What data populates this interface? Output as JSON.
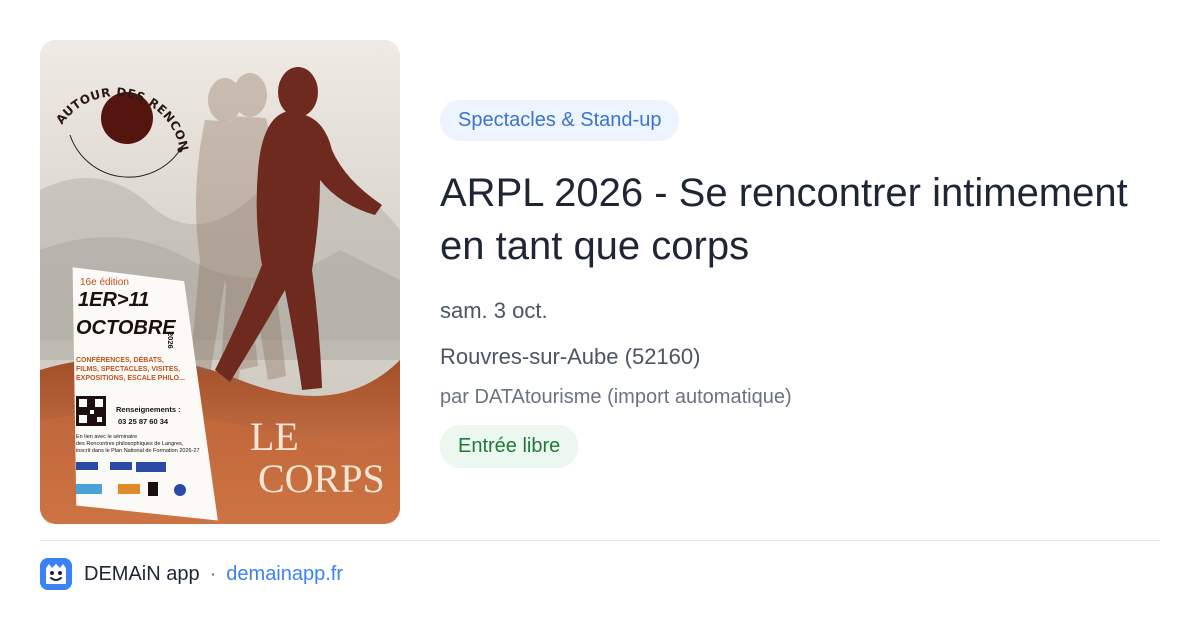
{
  "poster": {
    "arc_text": "AUTOUR DES RENCONTRES PHILOSOPHIQUES DE LANGRES",
    "edition": "16e édition",
    "dates_line1": "1ER>11",
    "dates_line2": "OCTOBRE",
    "year": "2026",
    "activities": [
      "CONFÉRENCES, DÉBATS,",
      "FILMS, SPECTACLES, VISITES,",
      "EXPOSITIONS, ESCALE PHILO..."
    ],
    "info_label": "Renseignements :",
    "info_phone": "03 25 87 60 34",
    "note": [
      "En lien avec le séminaire",
      "des Rencontres philosophiques de Langres,",
      "inscrit dans le Plan National de Formation 2026-27"
    ],
    "title_line1": "LE",
    "title_line2": "CORPS",
    "colors": {
      "earth": "#b9612f",
      "figure": "#6e2a1e",
      "dark": "#3b120e"
    }
  },
  "event": {
    "category": "Spectacles & Stand-up",
    "title": "ARPL 2026 - Se rencontrer intimement en tant que corps",
    "date": "sam. 3 oct.",
    "location": "Rouvres-sur-Aube (52160)",
    "source": "par DATAtourisme (import automatique)",
    "price": "Entrée libre"
  },
  "footer": {
    "app_name": "DEMAiN app",
    "separator": "·",
    "site": "demainapp.fr",
    "logo_icon": "smiley-app-icon"
  },
  "colors": {
    "tag_bg": "#edf4fe",
    "tag_text": "#3c74c7",
    "price_bg": "#ecf8ef",
    "price_text": "#1f7a3a",
    "link": "#3b82f6"
  }
}
